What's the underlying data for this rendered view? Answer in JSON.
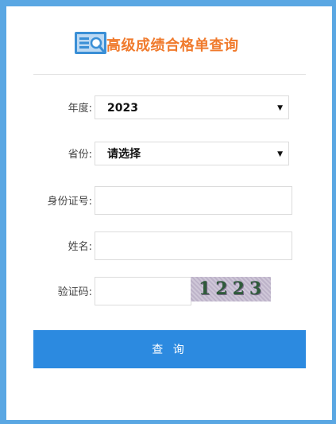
{
  "header": {
    "title": "高级成绩合格单查询",
    "icon": "search-document-icon"
  },
  "form": {
    "year": {
      "label": "年度:",
      "value": "2023"
    },
    "province": {
      "label": "省份:",
      "value": "请选择"
    },
    "id_number": {
      "label": "身份证号:",
      "value": ""
    },
    "name": {
      "label": "姓名:",
      "value": ""
    },
    "captcha": {
      "label": "验证码:",
      "value": "",
      "image_text": "1223"
    }
  },
  "actions": {
    "query_label": "查 询"
  },
  "colors": {
    "background": "#5aa7e3",
    "title": "#f07a2c",
    "button": "#2c8ae0",
    "icon": "#3a8fd6"
  }
}
